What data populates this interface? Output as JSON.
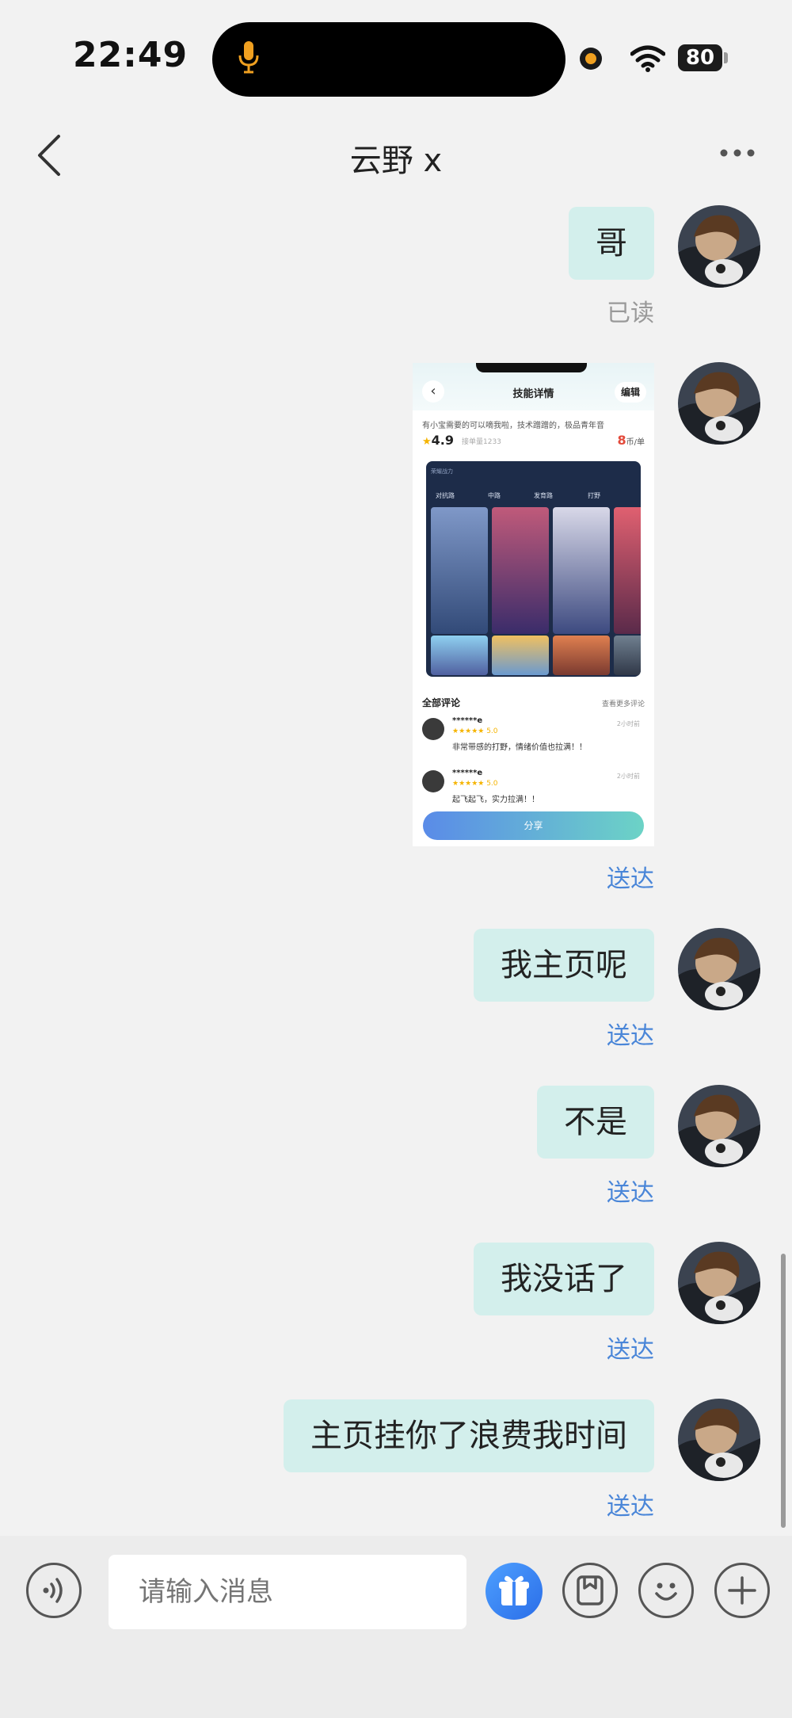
{
  "status_bar": {
    "time": "22:49",
    "battery": "80"
  },
  "header": {
    "title": "云野 x"
  },
  "messages": [
    {
      "text": "哥",
      "receipt": "已读"
    },
    {
      "type": "image",
      "receipt": "送达"
    },
    {
      "text": "我主页呢",
      "receipt": "送达"
    },
    {
      "text": "不是",
      "receipt": "送达"
    },
    {
      "text": "我没话了",
      "receipt": "送达"
    },
    {
      "text": "主页挂你了浪费我时间",
      "receipt": "送达"
    }
  ],
  "shared_image": {
    "title": "技能详情",
    "edit": "编辑",
    "desc": "有小宝需要的可以嘀我啦，技术蹭蹭的，极品青年音",
    "rating": "4.9",
    "count": "接单量1233",
    "price": "8",
    "price_unit": "币/单",
    "panel_label": "荣耀战力",
    "tabs": [
      "对抗路",
      "中路",
      "发育路",
      "打野"
    ],
    "all_reviews": "全部评论",
    "more_reviews": "查看更多评论",
    "reviews": [
      {
        "name": "******e",
        "stars": "★★★★★ 5.0",
        "time": "2小时前",
        "text": "非常带感的打野，情绪价值也拉满！！"
      },
      {
        "name": "******e",
        "stars": "★★★★★ 5.0",
        "time": "2小时前",
        "text": "起飞起飞，实力拉满！！"
      }
    ],
    "share": "分享"
  },
  "composer": {
    "placeholder": "请输入消息"
  },
  "icons": {
    "voice": "voice-wave-icon",
    "gift": "gift-icon",
    "sticker": "sticker-icon",
    "emoji": "smile-icon",
    "add": "plus-icon"
  },
  "colors": {
    "bubble": "#d3efec",
    "delivered": "#4a86d8",
    "read": "#999999",
    "background": "#f2f2f2"
  }
}
